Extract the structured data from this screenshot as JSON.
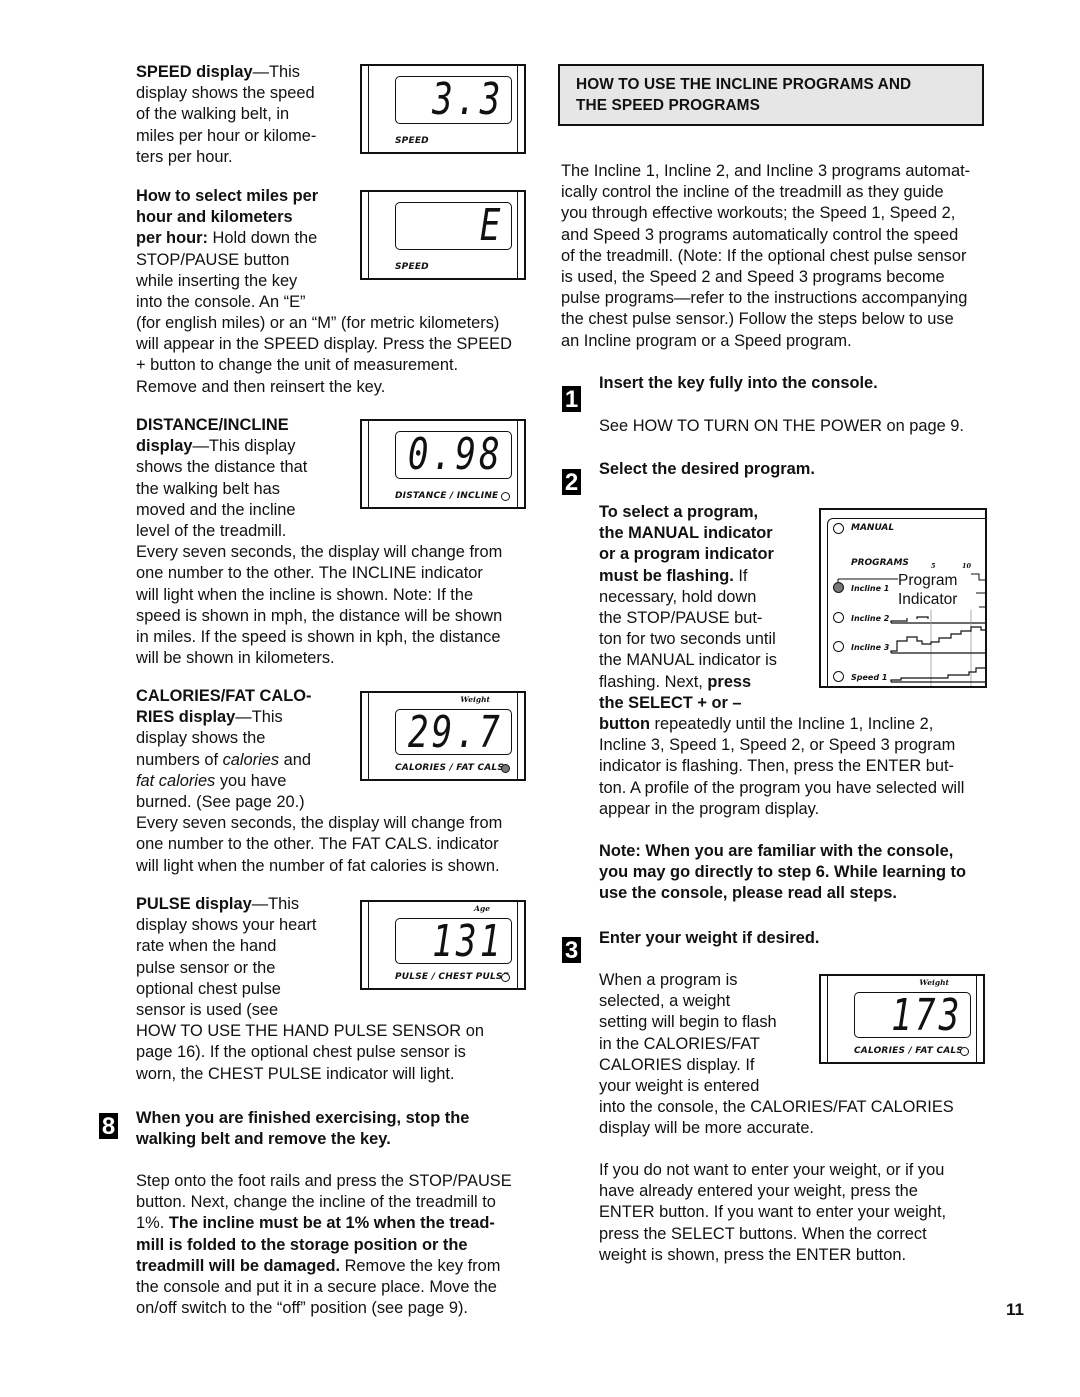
{
  "left": {
    "speed": {
      "heading": "SPEED display",
      "lines": [
        "—This",
        "display shows the speed",
        "of the walking belt, in",
        "miles per hour or kilome-",
        "ters per hour."
      ],
      "display1": {
        "value": "3.3",
        "label": "SPEED"
      },
      "display2": {
        "value": "E",
        "label": "SPEED"
      }
    },
    "units": {
      "bold_lines": [
        "How to select miles per",
        "hour and kilometers",
        "per hour:"
      ],
      "tail_first": " Hold down the",
      "narrow_lines": [
        "STOP/PAUSE button",
        "while inserting the key",
        "into the console. An “E”"
      ],
      "wide_lines": [
        "(for english miles) or an “M” (for metric kilometers)",
        "will appear in the SPEED display. Press the SPEED",
        "+ button to change the unit of measurement.",
        "Remove and then reinsert the key."
      ]
    },
    "distance": {
      "heading1": "DISTANCE/INCLINE",
      "heading2": "display",
      "first_tail": "—This display",
      "narrow_lines": [
        "shows the distance that",
        "the walking belt has",
        "moved and the incline",
        "level of the treadmill."
      ],
      "wide_lines": [
        "Every seven seconds, the display will change from",
        "one number to the other. The INCLINE indicator",
        "will light when the incline is shown. Note: If the",
        "speed is shown in mph, the distance will be shown",
        "in miles. If the speed is shown in kph, the distance",
        "will be shown in kilometers."
      ],
      "display": {
        "value": "0.98",
        "label": "DISTANCE / INCLINE",
        "indicator_on": false
      }
    },
    "calories": {
      "heading1": "CALORIES/FAT CALO-",
      "heading2": "RIES display",
      "first_tail": "—This",
      "line_a": "display shows the",
      "line_b_pre": "numbers of ",
      "line_b_it": "calories",
      "line_b_post": " and",
      "line_c_it": "fat calories",
      "line_c_post": " you have",
      "line_d": "burned. (See page 20.)",
      "wide_lines": [
        "Every seven seconds, the display will change from",
        "one number to the other. The FAT CALS. indicator",
        "will light when the number of fat calories is shown."
      ],
      "display": {
        "value": "29.7",
        "label": "CALORIES / FAT CALS",
        "top_label": "Weight",
        "indicator_on": true
      }
    },
    "pulse": {
      "heading": "PULSE display",
      "first_tail": "—This",
      "narrow_lines": [
        "display shows your heart",
        "rate when the hand",
        "pulse sensor or the",
        "optional chest pulse",
        "sensor is used (see"
      ],
      "wide_lines": [
        "HOW TO USE THE HAND PULSE SENSOR on",
        "page 16). If the optional chest pulse sensor is",
        "worn, the CHEST PULSE indicator will light."
      ],
      "display": {
        "value": "131",
        "label": "PULSE / CHEST PULSE",
        "top_label": "Age",
        "indicator_on": false
      }
    },
    "step8": {
      "number": "8",
      "title_lines": [
        "When you are finished exercising, stop the",
        "walking belt and remove the key."
      ],
      "line1": "Step onto the foot rails and press the STOP/PAUSE",
      "line2": "button. Next, change the incline of the treadmill to",
      "line3_pre": "1%. ",
      "line3_bold": "The incline must be at 1% when the tread-",
      "line4_bold": "mill is folded to the storage position or the",
      "line5_bold": "treadmill will be damaged.",
      "line5_post": " Remove the key from",
      "line6": "the console and put it in a secure place. Move the",
      "line7": "on/off switch to the “off” position (see page 9)."
    }
  },
  "right": {
    "header": [
      "HOW TO USE THE INCLINE PROGRAMS AND",
      "THE SPEED PROGRAMS"
    ],
    "intro": [
      "The Incline 1, Incline 2, and Incline 3 programs automat-",
      "ically control the incline of the treadmill as they guide",
      "you through effective workouts; the Speed 1, Speed 2,",
      "and Speed 3 programs automatically control the speed",
      "of the treadmill. (Note: If the optional chest pulse sensor",
      "is used, the Speed 2 and Speed 3 programs become",
      "pulse programs—refer to the instructions accompanying",
      "the chest pulse sensor.) Follow the steps below to use",
      "an Incline program or a Speed program."
    ],
    "step1": {
      "number": "1",
      "title": "Insert the key fully into the console.",
      "body": "See HOW TO TURN ON THE POWER on page 9."
    },
    "step2": {
      "number": "2",
      "title": "Select the desired program.",
      "bold_lines": [
        "To select a program,",
        "the MANUAL indicator",
        "or a program indicator",
        "must be flashing."
      ],
      "if": " If",
      "narrow_lines": [
        "necessary, hold down",
        "the STOP/PAUSE but-",
        "ton for two seconds until",
        "the MANUAL indicator is"
      ],
      "flash_pre": "flashing. Next, ",
      "flash_bold": "press",
      "select_bold": "the SELECT + or –",
      "button_bold": "button",
      "button_post": " repeatedly until the Incline 1, Incline 2,",
      "wide_lines": [
        "Incline 3, Speed 1, Speed 2, or Speed 3 program",
        "indicator is flashing. Then, press the ENTER but-",
        "ton. A profile of the program you have selected will",
        "appear in the program display."
      ],
      "panel": {
        "manual": "MANUAL",
        "programs": "PROGRAMS",
        "tick5": "5",
        "tick10": "10",
        "callout": [
          "Program",
          "Indicator"
        ],
        "rows": [
          {
            "label": "Incline 1",
            "on": true
          },
          {
            "label": "Incline 2",
            "on": false
          },
          {
            "label": "Incline 3",
            "on": false
          },
          {
            "label": "Speed 1",
            "on": false
          }
        ]
      }
    },
    "note": [
      "Note: When you are familiar with the console,",
      "you may go directly to step 6. While learning to",
      "use the console, please read all steps."
    ],
    "step3": {
      "number": "3",
      "title": "Enter your weight if desired.",
      "narrow_lines": [
        "When a program is",
        "selected, a weight",
        "setting will begin to flash",
        "in the CALORIES/FAT",
        "CALORIES display. If",
        "your weight is entered"
      ],
      "wide_lines": [
        "into the console, the CALORIES/FAT CALORIES",
        "display will be more accurate."
      ],
      "display": {
        "value": "173",
        "label": "CALORIES / FAT CALS",
        "top_label": "Weight",
        "indicator_on": false
      },
      "para2": [
        "If you do not want to enter your weight, or if you",
        "have already entered your weight, press the",
        "ENTER button. If you want to enter your weight,",
        "press the SELECT buttons. When the correct",
        "weight is shown, press the ENTER button."
      ]
    }
  },
  "page_number": "11"
}
